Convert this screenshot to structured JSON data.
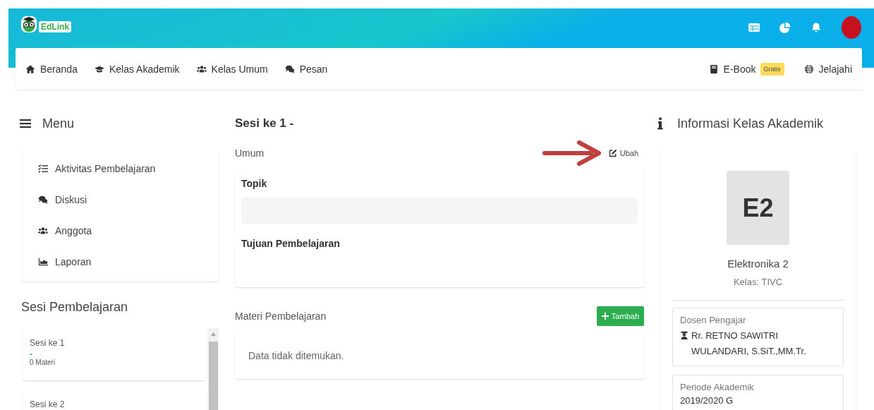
{
  "header": {
    "logo_text": "EdLink"
  },
  "nav": {
    "items": [
      "Beranda",
      "Kelas Akademik",
      "Kelas Umum",
      "Pesan"
    ],
    "ebook": {
      "label": "E-Book",
      "badge": "Gratis"
    },
    "explore": "Jelajahi"
  },
  "menu": {
    "title": "Menu",
    "items": [
      "Aktivitas Pembelajaran",
      "Diskusi",
      "Anggota",
      "Laporan"
    ]
  },
  "sessions": {
    "title": "Sesi Pembelajaran",
    "items": [
      {
        "title": "Sesi ke 1",
        "status": "-",
        "count": "0 Materi"
      },
      {
        "title": "Sesi ke 2"
      }
    ]
  },
  "session_detail": {
    "title": "Sesi ke 1 -",
    "general": {
      "label": "Umum",
      "edit": "Ubah",
      "fields": [
        {
          "label": "Topik",
          "kind": "box"
        },
        {
          "label": "Tujuan Pembelajaran",
          "kind": "text"
        }
      ]
    },
    "materials": {
      "label": "Materi Pembelajaran",
      "add": "Tambah",
      "empty": "Data tidak ditemukan."
    }
  },
  "info": {
    "title": "Informasi Kelas Akademik",
    "code": "E2",
    "name": "Elektronika 2",
    "class": "Kelas: TIVC",
    "lecturer": {
      "label": "Dosen Pengajar",
      "name": "Rr. RETNO SAWITRI WULANDARI, S.SiT.,MM.Tr."
    },
    "period": {
      "label": "Periode Akademik",
      "value": "2019/2020 G"
    }
  }
}
